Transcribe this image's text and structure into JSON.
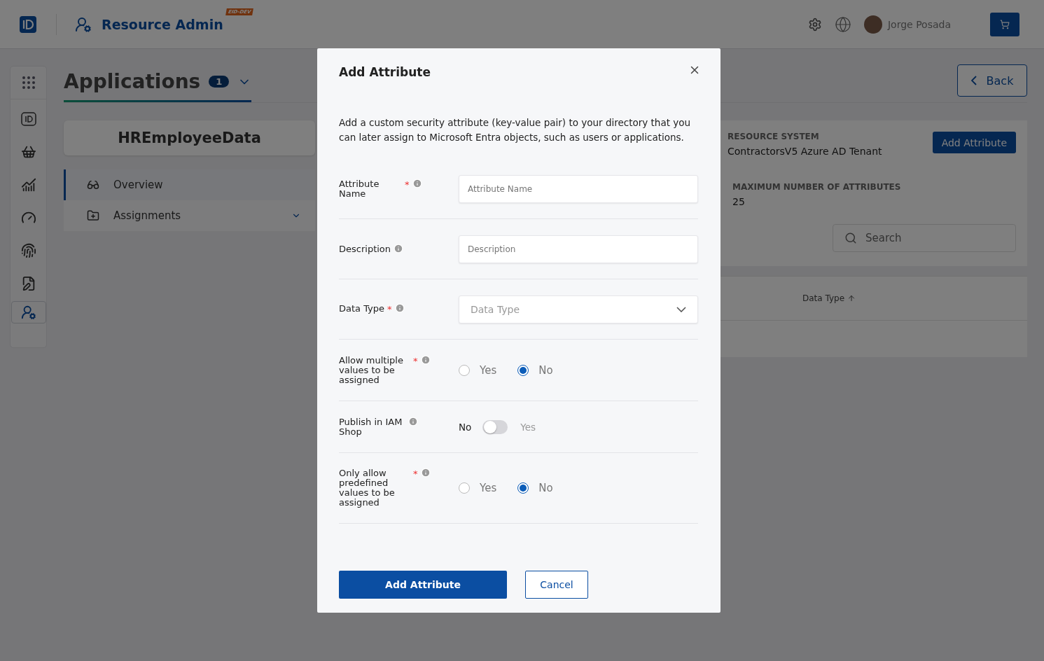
{
  "header": {
    "app_title": "Resource Admin",
    "env_badge": "EID-DEV",
    "user_name": "Jorge Posada"
  },
  "rail": {
    "items": [
      {
        "kind": "id",
        "selected": false
      },
      {
        "kind": "cart",
        "selected": false
      },
      {
        "kind": "chart",
        "selected": false
      },
      {
        "kind": "gauge",
        "selected": false
      },
      {
        "kind": "fingerprint",
        "selected": false
      },
      {
        "kind": "form",
        "selected": false
      },
      {
        "kind": "admin",
        "selected": true
      }
    ]
  },
  "page": {
    "title": "Applications",
    "count": "1",
    "back_label": "Back"
  },
  "app_card": {
    "name": "HREmployeeData"
  },
  "nav": [
    {
      "label": "Overview",
      "selected": true,
      "expandable": false
    },
    {
      "label": "Assignments",
      "selected": false,
      "expandable": true
    }
  ],
  "details": {
    "resource_system_label": "RESOURCE SYSTEM",
    "resource_system": "ContractorsV5 Azure AD Tenant",
    "max_label": "MAXIMUM NUMBER OF ATTRIBUTES",
    "max_value": "25",
    "add_button": "Add Attribute",
    "search_placeholder": "Search",
    "table_columns": [
      {
        "label": "Data Type",
        "sorted": true
      }
    ]
  },
  "dialog": {
    "title": "Add Attribute",
    "intro": "Add a custom security attribute (key-value pair) to your directory that you can later assign to Microsoft Entra objects, such as users or applications.",
    "fields": [
      {
        "kind": "text",
        "label": "Attribute Name",
        "required_mark": "*",
        "placeholder": "Attribute Name"
      },
      {
        "kind": "text",
        "label": "Description",
        "placeholder": "Description"
      },
      {
        "kind": "select",
        "label": "Data Type",
        "required_mark": "*",
        "placeholder": "Data Type"
      },
      {
        "kind": "radio",
        "label": "Allow multiple values to be assigned",
        "required_mark": "*",
        "options": [
          {
            "label": "Yes",
            "selected": false
          },
          {
            "label": "No",
            "selected": true
          }
        ]
      },
      {
        "kind": "toggle",
        "label": "Publish in IAM Shop",
        "off_label": "No",
        "on_label": "Yes",
        "on": false
      },
      {
        "kind": "radio",
        "label": "Only allow predefined values to be assigned",
        "required_mark": "*",
        "options": [
          {
            "label": "Yes",
            "selected": false
          },
          {
            "label": "No",
            "selected": true
          }
        ]
      }
    ],
    "primary_button": "Add Attribute",
    "cancel_button": "Cancel"
  }
}
